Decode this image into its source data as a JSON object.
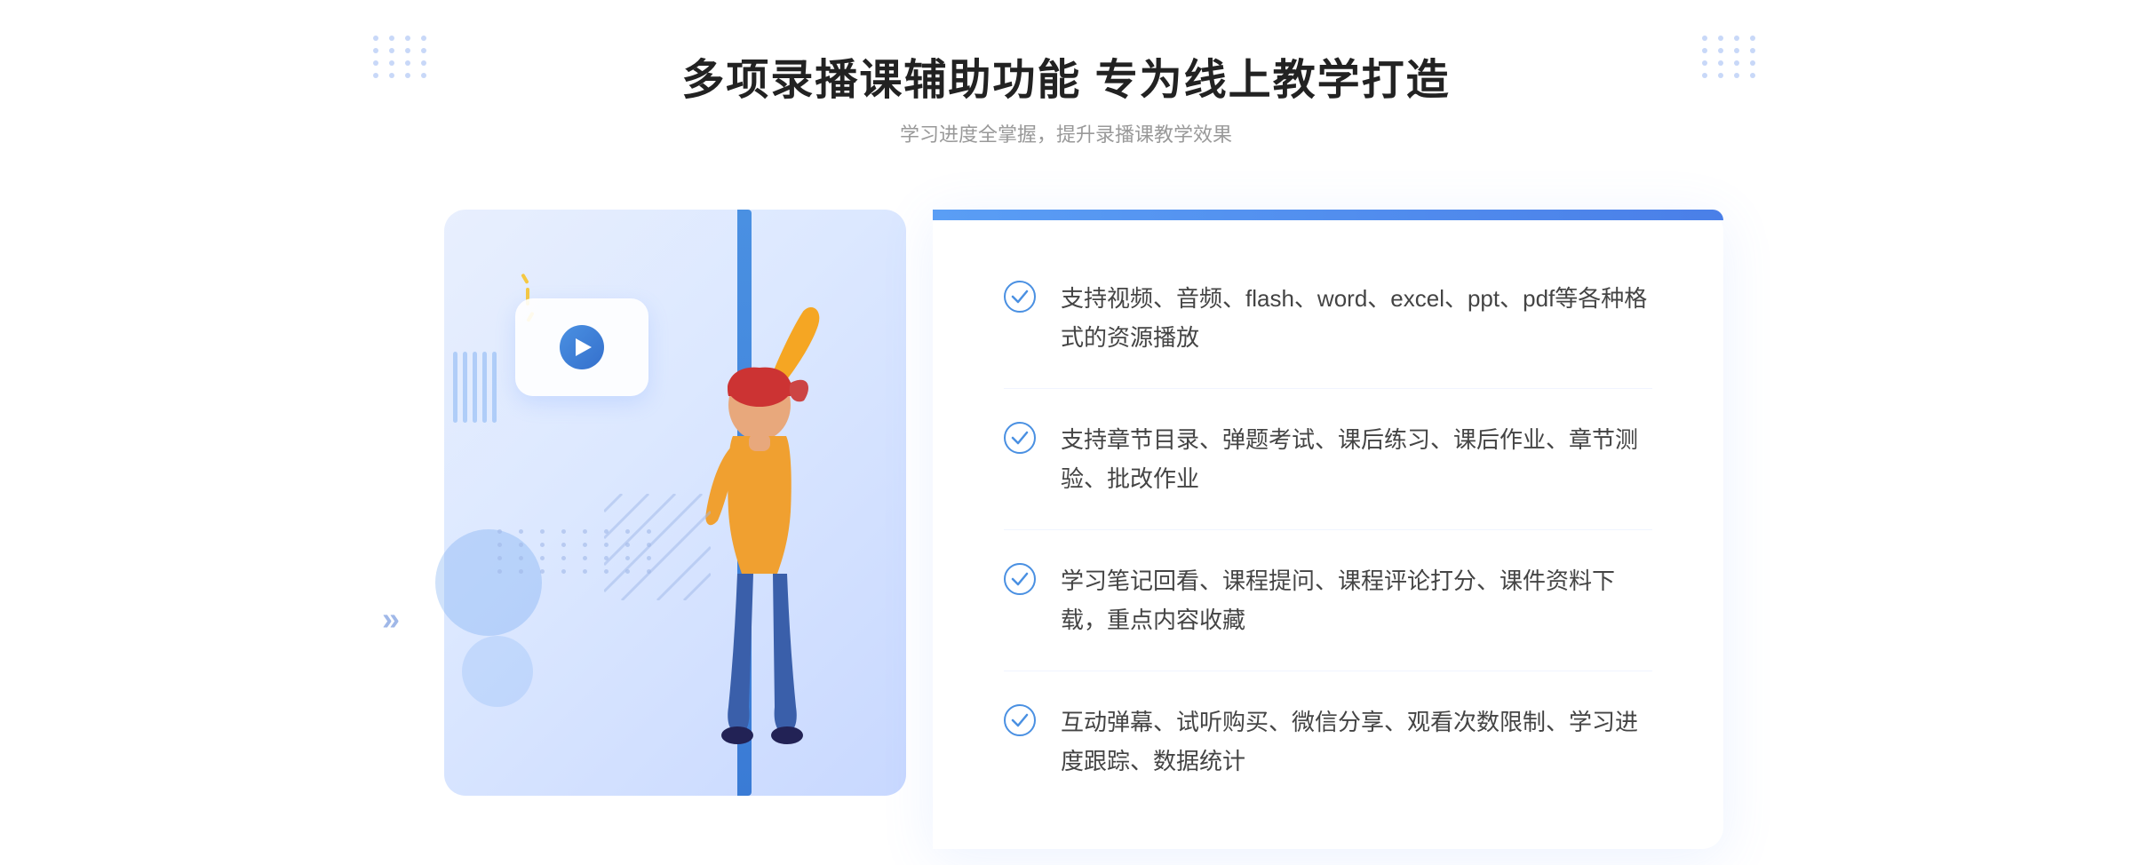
{
  "page": {
    "background": "#ffffff"
  },
  "header": {
    "main_title": "多项录播课辅助功能 专为线上教学打造",
    "sub_title": "学习进度全掌握，提升录播课教学效果"
  },
  "features": [
    {
      "id": "feature-1",
      "text": "支持视频、音频、flash、word、excel、ppt、pdf等各种格式的资源播放"
    },
    {
      "id": "feature-2",
      "text": "支持章节目录、弹题考试、课后练习、课后作业、章节测验、批改作业"
    },
    {
      "id": "feature-3",
      "text": "学习笔记回看、课程提问、课程评论打分、课件资料下载，重点内容收藏"
    },
    {
      "id": "feature-4",
      "text": "互动弹幕、试听购买、微信分享、观看次数限制、学习进度跟踪、数据统计"
    }
  ],
  "icons": {
    "check": "✓",
    "play": "▶",
    "left_arrow": "»"
  },
  "colors": {
    "primary_blue": "#4a90e2",
    "light_blue": "#c8d8ff",
    "text_dark": "#222222",
    "text_medium": "#444444",
    "text_light": "#999999",
    "check_color": "#4a90e2"
  }
}
